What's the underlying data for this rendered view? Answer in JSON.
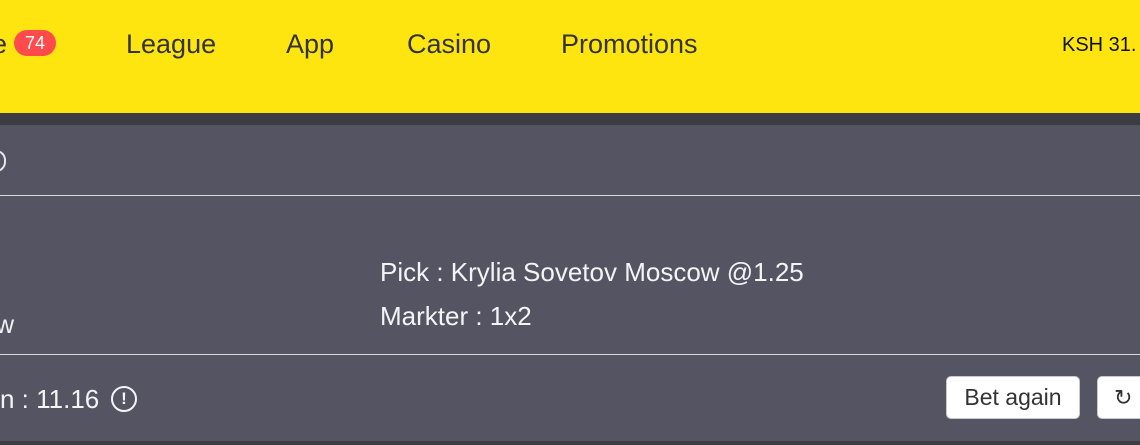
{
  "nav": {
    "live_label_partial": "e",
    "live_count": "74",
    "items": [
      "League",
      "App",
      "Casino",
      "Promotions"
    ],
    "balance_partial": "KSH 31."
  },
  "bet": {
    "body_clipped_text": "w",
    "pick_line": "Pick : Krylia Sovetov Moscow @1.25",
    "market_line": "Markter : 1x2",
    "win_line": "n : 11.16",
    "info_icon": "!",
    "bet_again_label": "Bet again",
    "refresh_icon": "↻"
  },
  "colors": {
    "nav_bg": "#ffe510",
    "badge_bg": "#ff4b4b",
    "card_bg": "#545462"
  }
}
